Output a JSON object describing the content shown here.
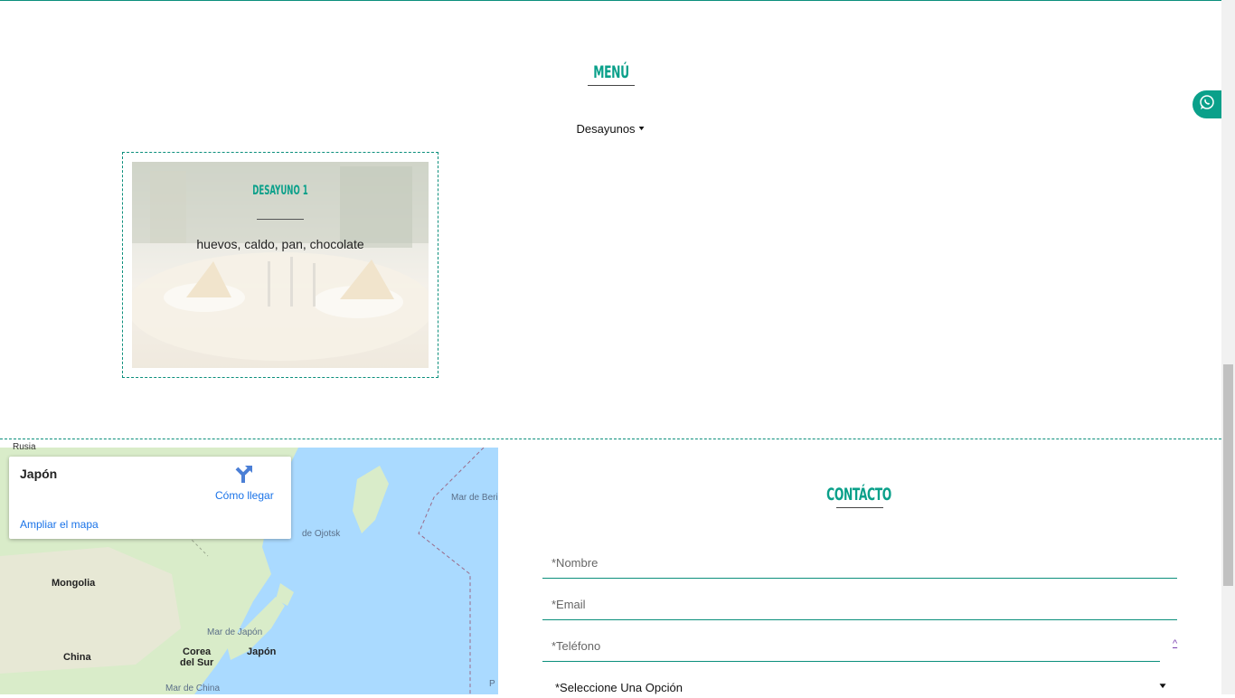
{
  "menu": {
    "title": "Menú",
    "category": "Desayunos",
    "items": [
      {
        "name": "Desayuno 1",
        "description": "huevos, caldo, pan, chocolate"
      }
    ]
  },
  "map": {
    "card": {
      "place": "Japón",
      "directions_label": "Cómo llegar",
      "enlarge_label": "Ampliar el mapa"
    },
    "labels": {
      "mongolia": "Mongolia",
      "china": "China",
      "korea_line1": "Corea",
      "korea_line2": "del Sur",
      "japan": "Japón",
      "sea_okhotsk": "de Ojotsk",
      "sea_bering": "Mar de Beri",
      "sea_japan": "Mar de Japón",
      "sea_china": "Mar de China",
      "edge_p": "P",
      "top_cut": "Rusia"
    }
  },
  "contact": {
    "title": "Contácto",
    "fields": {
      "name_placeholder": "*Nombre",
      "email_placeholder": "*Email",
      "phone_placeholder": "*Teléfono"
    },
    "select_label": "*Seleccione Una Opción",
    "scroll_top": "^"
  },
  "icons": {
    "whatsapp": "whatsapp-icon",
    "directions": "directions-icon",
    "chevron": "chevron-down-icon"
  },
  "colors": {
    "accent": "#0aa08a",
    "link": "#1a73e8",
    "water": "#aadaff",
    "land": "#d9ecc9"
  }
}
